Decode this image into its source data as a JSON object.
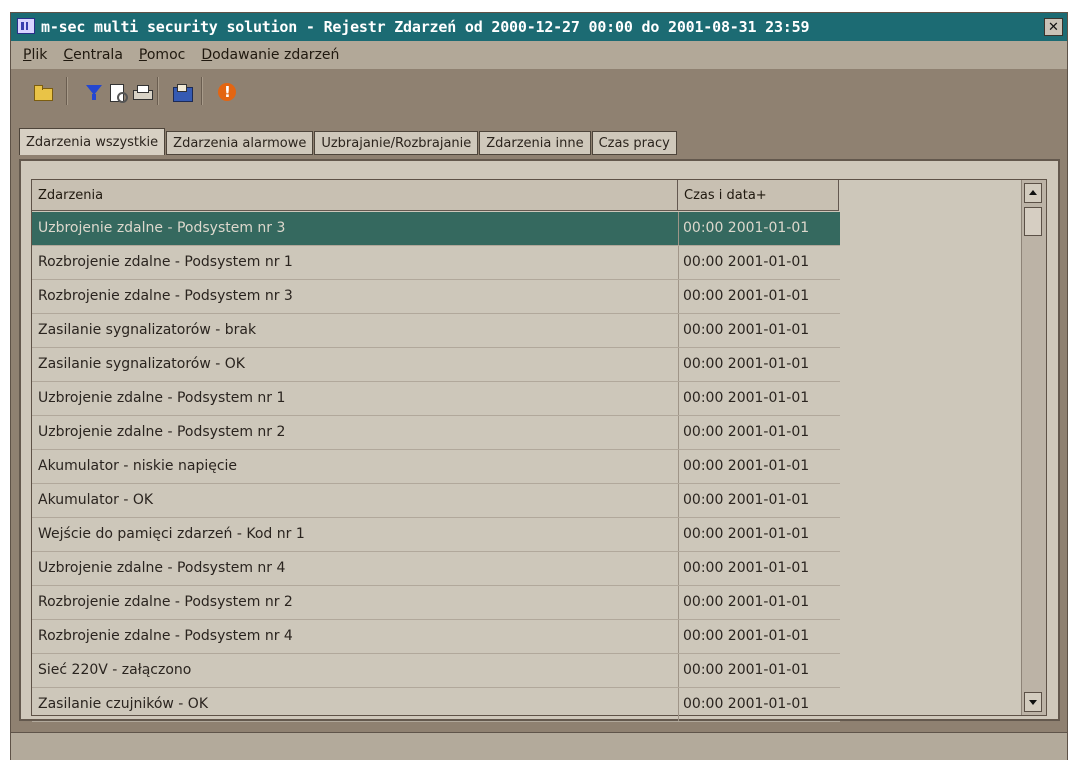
{
  "window": {
    "title": "m-sec multi security solution - Rejestr Zdarzeń od 2000-12-27 00:00 do 2001-08-31 23:59"
  },
  "menu": [
    {
      "label": "Plik"
    },
    {
      "label": "Centrala"
    },
    {
      "label": "Pomoc"
    },
    {
      "label": "Dodawanie zdarzeń"
    }
  ],
  "toolbar": {
    "icons": [
      "folder-open-icon",
      "filter-icon",
      "print-preview-icon",
      "print-icon",
      "export-icon",
      "alert-icon"
    ]
  },
  "tabs": [
    {
      "label": "Zdarzenia wszystkie",
      "active": true
    },
    {
      "label": "Zdarzenia alarmowe",
      "active": false
    },
    {
      "label": "Uzbrajanie/Rozbrajanie",
      "active": false
    },
    {
      "label": "Zdarzenia inne",
      "active": false
    },
    {
      "label": "Czas pracy",
      "active": false
    }
  ],
  "table": {
    "columns": [
      "Zdarzenia",
      "Czas i data+"
    ],
    "rows": [
      {
        "event": "Uzbrojenie zdalne - Podsystem nr 3",
        "time": "00:00 2001-01-01",
        "selected": true
      },
      {
        "event": "Rozbrojenie zdalne - Podsystem nr 1",
        "time": "00:00 2001-01-01",
        "selected": false
      },
      {
        "event": "Rozbrojenie zdalne - Podsystem nr 3",
        "time": "00:00 2001-01-01",
        "selected": false
      },
      {
        "event": "Zasilanie sygnalizatorów - brak",
        "time": "00:00 2001-01-01",
        "selected": false
      },
      {
        "event": "Zasilanie sygnalizatorów - OK",
        "time": "00:00 2001-01-01",
        "selected": false
      },
      {
        "event": "Uzbrojenie zdalne - Podsystem nr 1",
        "time": "00:00 2001-01-01",
        "selected": false
      },
      {
        "event": "Uzbrojenie zdalne - Podsystem nr 2",
        "time": "00:00 2001-01-01",
        "selected": false
      },
      {
        "event": "Akumulator - niskie napięcie",
        "time": "00:00 2001-01-01",
        "selected": false
      },
      {
        "event": "Akumulator - OK",
        "time": "00:00 2001-01-01",
        "selected": false
      },
      {
        "event": "Wejście do pamięci zdarzeń - Kod nr 1",
        "time": "00:00 2001-01-01",
        "selected": false
      },
      {
        "event": "Uzbrojenie zdalne - Podsystem nr 4",
        "time": "00:00 2001-01-01",
        "selected": false
      },
      {
        "event": "Rozbrojenie zdalne - Podsystem nr 2",
        "time": "00:00 2001-01-01",
        "selected": false
      },
      {
        "event": "Rozbrojenie zdalne - Podsystem nr 4",
        "time": "00:00 2001-01-01",
        "selected": false
      },
      {
        "event": "Sieć 220V - załączono",
        "time": "00:00 2001-01-01",
        "selected": false
      },
      {
        "event": "Zasilanie czujników - OK",
        "time": "00:00 2001-01-01",
        "selected": false
      }
    ]
  },
  "statusbar": {
    "text": ""
  },
  "colors": {
    "titlebar": "#1c6b73",
    "selection": "#35695f",
    "window": "#8f8171"
  }
}
